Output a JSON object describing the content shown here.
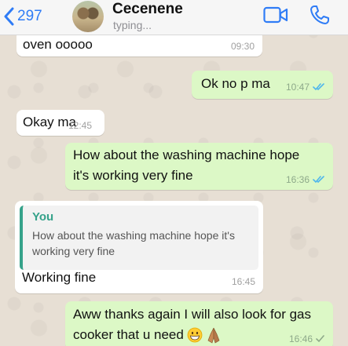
{
  "header": {
    "back_count": "297",
    "contact_name": "Cecenene",
    "status": "typing..."
  },
  "messages": [
    {
      "direction": "in",
      "text": "oven ooooo",
      "time": "09:30"
    },
    {
      "direction": "out",
      "text": "Ok no p ma",
      "time": "10:47",
      "status": "read"
    },
    {
      "direction": "in",
      "text": "Okay ma",
      "time": "12:45"
    },
    {
      "direction": "out",
      "text_line1": "How about the washing machine hope",
      "text_line2": "it's working very fine",
      "time": "16:36",
      "status": "read"
    },
    {
      "direction": "in",
      "reply_to": {
        "author": "You",
        "text_line1": "How about the washing machine hope it's",
        "text_line2": "working very fine"
      },
      "text": "Working fine",
      "time": "16:45"
    },
    {
      "direction": "out",
      "text_line1": "Aww thanks again I will also look for gas",
      "text_line2": "cooker that u need",
      "emojis": [
        "grinning-face-emoji",
        "folded-hands-emoji"
      ],
      "time": "16:46",
      "status": "sent"
    }
  ],
  "colors": {
    "accent": "#2f7cf6",
    "incoming_bubble": "#ffffff",
    "outgoing_bubble": "#dcf8c6",
    "quote_accent": "#35a28a",
    "read_tick": "#4fb6ec"
  }
}
